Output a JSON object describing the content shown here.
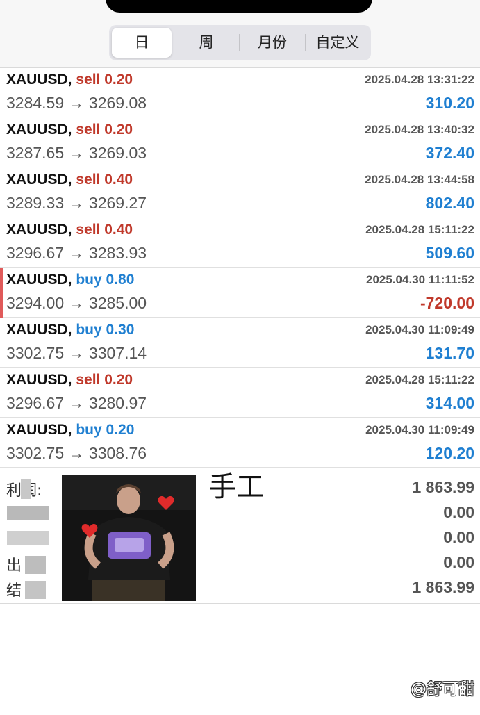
{
  "tabs": [
    {
      "label": "日",
      "active": true
    },
    {
      "label": "周",
      "active": false
    },
    {
      "label": "月份",
      "active": false
    },
    {
      "label": "自定义",
      "active": false
    }
  ],
  "colors": {
    "sell": "#c0392b",
    "buy": "#1f7fd1",
    "profit_positive": "#1f7fd1",
    "profit_negative": "#c0392b"
  },
  "trades": [
    {
      "symbol": "XAUUSD,",
      "side": "sell",
      "volume": "0.20",
      "time": "2025.04.28 13:31:22",
      "open": "3284.59",
      "close": "3269.08",
      "profit": "310.20",
      "marked": false
    },
    {
      "symbol": "XAUUSD,",
      "side": "sell",
      "volume": "0.20",
      "time": "2025.04.28 13:40:32",
      "open": "3287.65",
      "close": "3269.03",
      "profit": "372.40",
      "marked": false
    },
    {
      "symbol": "XAUUSD,",
      "side": "sell",
      "volume": "0.40",
      "time": "2025.04.28 13:44:58",
      "open": "3289.33",
      "close": "3269.27",
      "profit": "802.40",
      "marked": false
    },
    {
      "symbol": "XAUUSD,",
      "side": "sell",
      "volume": "0.40",
      "time": "2025.04.28 15:11:22",
      "open": "3296.67",
      "close": "3283.93",
      "profit": "509.60",
      "marked": false
    },
    {
      "symbol": "XAUUSD,",
      "side": "buy",
      "volume": "0.80",
      "time": "2025.04.30 11:11:52",
      "open": "3294.00",
      "close": "3285.00",
      "profit": "-720.00",
      "marked": true
    },
    {
      "symbol": "XAUUSD,",
      "side": "buy",
      "volume": "0.30",
      "time": "2025.04.30 11:09:49",
      "open": "3302.75",
      "close": "3307.14",
      "profit": "131.70",
      "marked": false
    },
    {
      "symbol": "XAUUSD,",
      "side": "sell",
      "volume": "0.20",
      "time": "2025.04.28 15:11:22",
      "open": "3296.67",
      "close": "3280.97",
      "profit": "314.00",
      "marked": false
    },
    {
      "symbol": "XAUUSD,",
      "side": "buy",
      "volume": "0.20",
      "time": "2025.04.30 11:09:49",
      "open": "3302.75",
      "close": "3308.76",
      "profit": "120.20",
      "marked": false
    }
  ],
  "arrow": "→",
  "summary": [
    {
      "label": "利润:",
      "value": "1 863.99"
    },
    {
      "label": "",
      "value": "0.00"
    },
    {
      "label": "",
      "value": "0.00"
    },
    {
      "label": "出",
      "value": "0.00"
    },
    {
      "label": "结",
      "value": "1 863.99"
    }
  ],
  "handwritten_note": "手工",
  "watermark": "@舒可甜"
}
